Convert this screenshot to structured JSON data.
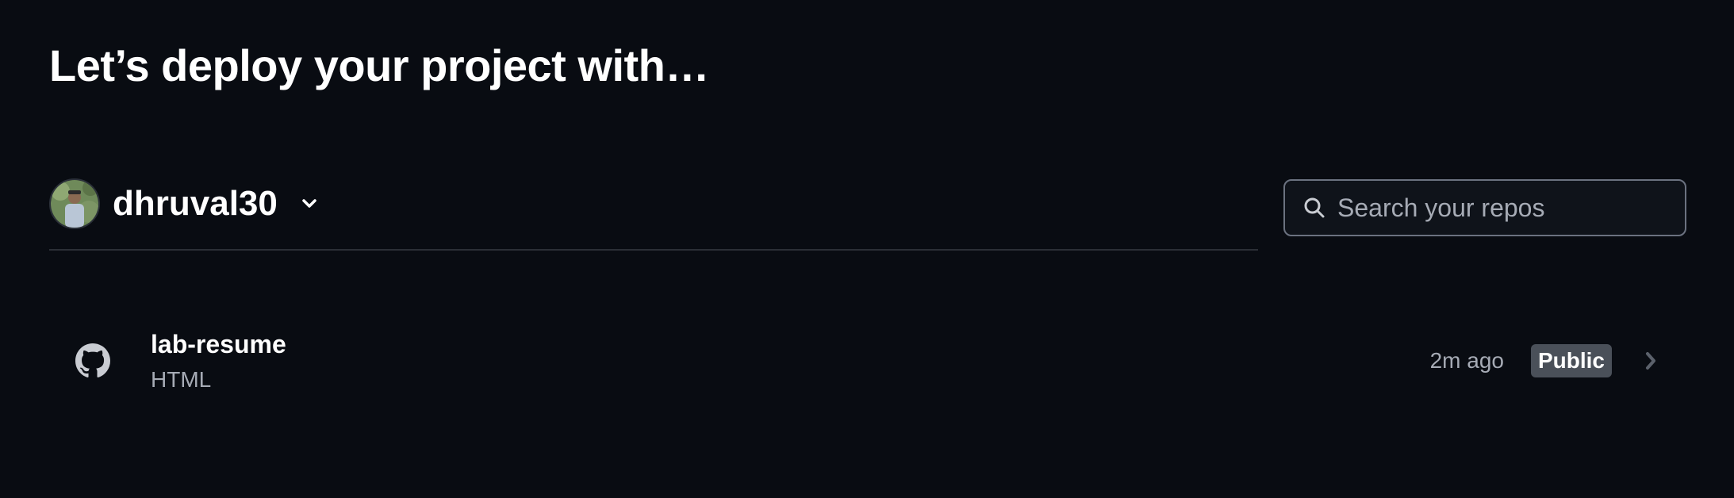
{
  "header": {
    "title": "Let’s deploy your project with…"
  },
  "account": {
    "name": "dhruval30"
  },
  "search": {
    "placeholder": "Search your repos",
    "value": ""
  },
  "repos": [
    {
      "name": "lab-resume",
      "language": "HTML",
      "updated": "2m ago",
      "visibility": "Public",
      "icon": "github-icon"
    }
  ],
  "colors": {
    "background": "#090c12",
    "badge": "#4a5059",
    "muted_text": "#a6abb5"
  }
}
